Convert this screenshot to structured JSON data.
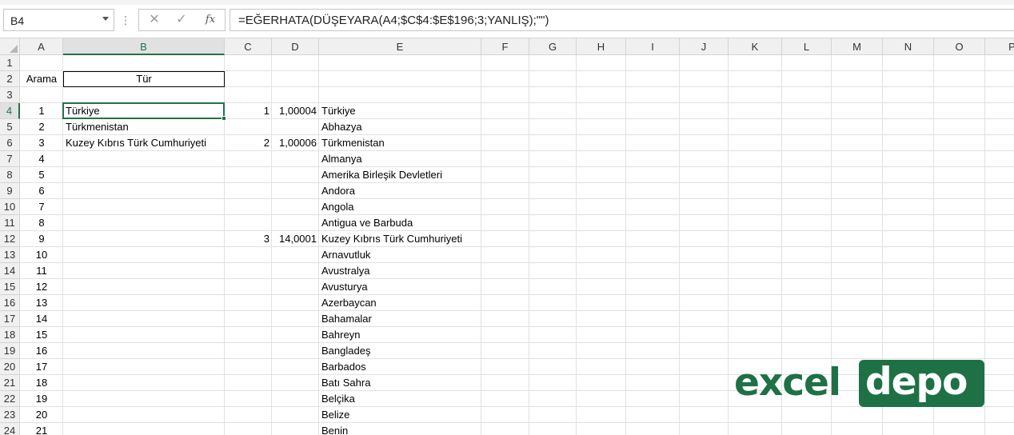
{
  "name_box": "B4",
  "formula": "=EĞERHATA(DÜŞEYARA(A4;$C$4:$E$196;3;YANLIŞ);\"\")",
  "formula_buttons": {
    "cancel": "✕",
    "enter": "✓",
    "insert_function": "fx"
  },
  "columns": [
    "A",
    "B",
    "C",
    "D",
    "E",
    "F",
    "G",
    "H",
    "I",
    "J",
    "K",
    "L",
    "M",
    "N",
    "O",
    "P"
  ],
  "rows": [
    "1",
    "2",
    "3",
    "4",
    "5",
    "6",
    "7",
    "8",
    "9",
    "10",
    "11",
    "12",
    "13",
    "14",
    "15",
    "16",
    "17",
    "18",
    "19",
    "20",
    "21",
    "22",
    "23",
    "24"
  ],
  "headers": {
    "a2": "Arama",
    "b2": "Tür"
  },
  "col_a": [
    "1",
    "2",
    "3",
    "4",
    "5",
    "6",
    "7",
    "8",
    "9",
    "10",
    "11",
    "12",
    "13",
    "14",
    "15",
    "16",
    "17",
    "18",
    "19",
    "20",
    "21"
  ],
  "col_b": [
    "Türkiye",
    "Türkmenistan",
    "Kuzey Kıbrıs Türk Cumhuriyeti"
  ],
  "col_c": {
    "r4": "1",
    "r6": "2",
    "r12": "3"
  },
  "col_d": {
    "r4": "1,00004",
    "r6": "1,00006",
    "r12": "14,0001"
  },
  "col_e": [
    "Türkiye",
    "Abhazya",
    "Türkmenistan",
    "Almanya",
    "Amerika Birleşik Devletleri",
    "Andora",
    "Angola",
    "Antigua ve Barbuda",
    "Kuzey Kıbrıs Türk Cumhuriyeti",
    "Arnavutluk",
    "Avustralya",
    "Avusturya",
    "Azerbaycan",
    "Bahamalar",
    "Bahreyn",
    "Bangladeş",
    "Barbados",
    "Batı Sahra",
    "Belçika",
    "Belize",
    "Benin"
  ],
  "logo": {
    "part1": "excel",
    "part2": "depo"
  },
  "colors": {
    "accent": "#217346",
    "logo": "#1e7145"
  }
}
